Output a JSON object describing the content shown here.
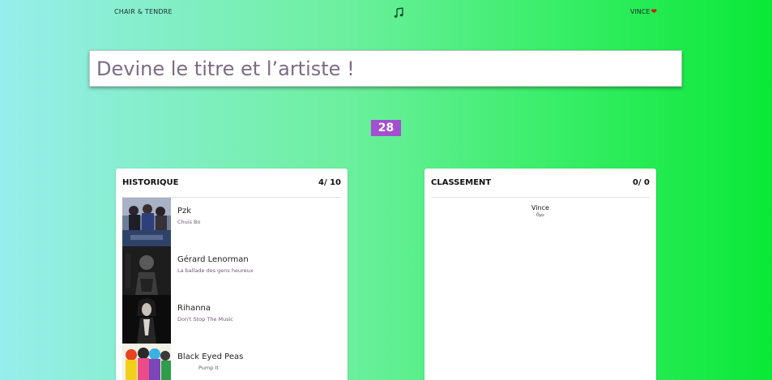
{
  "header": {
    "brand": "CHAIR & TENDRE",
    "music_icon": "music-note-icon",
    "user_name": "VINCE",
    "heart_icon": "heart-icon"
  },
  "guess": {
    "placeholder": "Devine le titre et l’artiste !"
  },
  "timer": {
    "value": "28"
  },
  "history": {
    "title": "HISTORIQUE",
    "count": "4/ 10",
    "items": [
      {
        "artist": "Pzk",
        "title": "Chuis Bo"
      },
      {
        "artist": "Gérard Lenorman",
        "title": "La ballade des gens heureux"
      },
      {
        "artist": "Rihanna",
        "title": "Don't Stop The Music"
      },
      {
        "artist": "Black Eyed Peas",
        "title": "Pump It"
      }
    ]
  },
  "ranking": {
    "title": "CLASSEMENT",
    "count": "0/ 0",
    "players": [
      {
        "name": "Vince",
        "score": "0",
        "unit": "pts"
      }
    ]
  },
  "colors": {
    "gradient_start": "#97eeec",
    "gradient_end": "#0ae836",
    "timer_bg": "#a44ed1",
    "heart": "#e01010"
  }
}
